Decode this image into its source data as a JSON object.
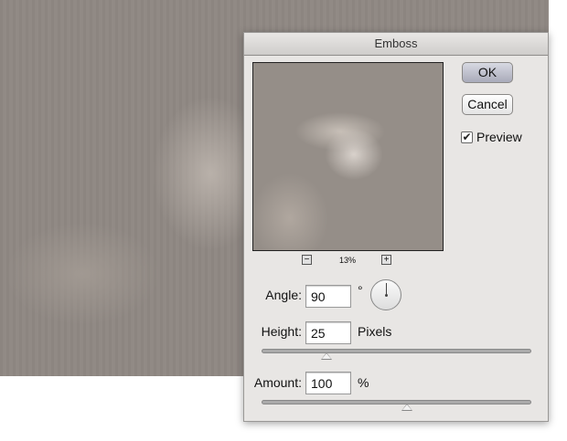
{
  "dialog": {
    "title": "Emboss",
    "ok_label": "OK",
    "cancel_label": "Cancel",
    "preview_label": "Preview",
    "preview_checked": true,
    "zoom": {
      "minus": "−",
      "plus": "+",
      "level": "13%"
    },
    "angle": {
      "label": "Angle:",
      "value": "90",
      "unit": "°"
    },
    "height": {
      "label": "Height:",
      "value": "25",
      "unit": "Pixels",
      "slider_fraction": 0.24
    },
    "amount": {
      "label": "Amount:",
      "value": "100",
      "unit": "%",
      "slider_fraction": 0.54
    }
  }
}
